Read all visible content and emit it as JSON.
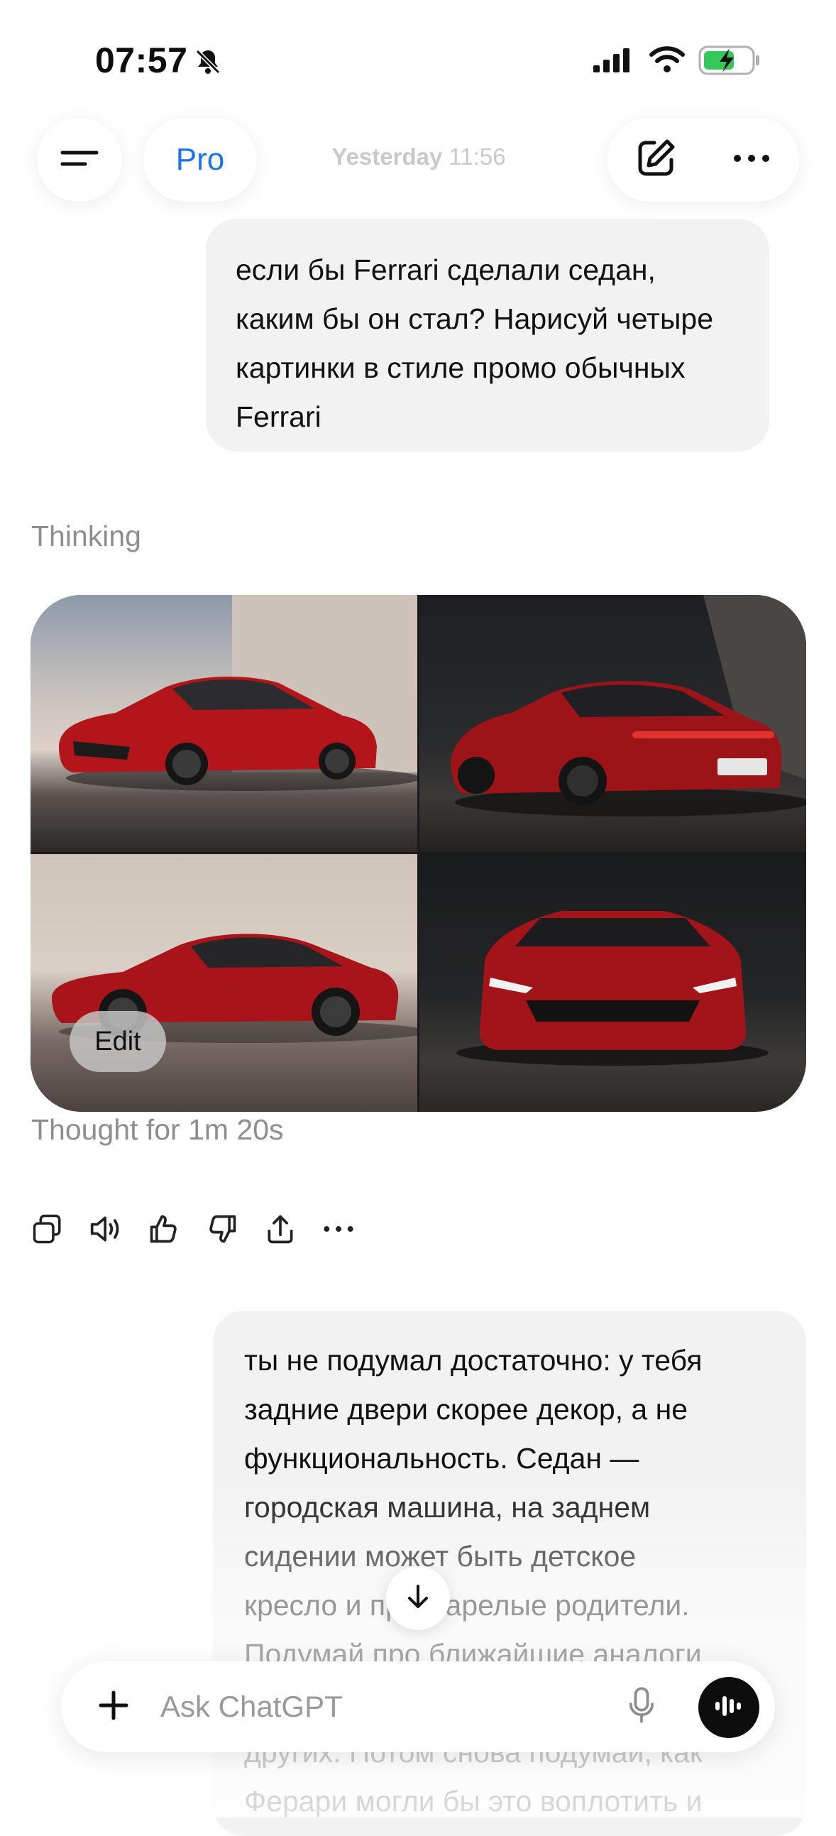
{
  "status_bar": {
    "time": "07:57",
    "icons": [
      "bell-slash-icon",
      "signal-icon",
      "wifi-icon",
      "battery-charging-icon"
    ],
    "battery_color": "#34c759"
  },
  "header": {
    "menu_icon": "menu-icon",
    "plan_label": "Pro",
    "timestamp_day": "Yesterday",
    "timestamp_time": "11:56",
    "actions": [
      "compose-icon",
      "more-icon"
    ],
    "accent_color": "#1a73e8"
  },
  "messages": {
    "user_1": "если бы Ferrari сделали седан, каким бы он стал? Нарисуй четыре картинки в стиле промо обычных Ferrari",
    "thinking_label": "Thinking",
    "images": [
      {
        "description": "red car front three-quarter view"
      },
      {
        "description": "red car rear three-quarter view"
      },
      {
        "description": "red car side profile"
      },
      {
        "description": "red car front view"
      }
    ],
    "edit_label": "Edit",
    "thought_duration": "Thought for 1m 20s",
    "actions": [
      "copy-icon",
      "speaker-icon",
      "thumbs-up-icon",
      "thumbs-down-icon",
      "share-icon",
      "more-icon"
    ],
    "user_2": "ты не подумал достаточно: у тебя\nзадние двери скорее декор, а не\nфункциональность. Седан —\nгородская машина, на заднем\nсидении может быть детское\nкресло и престарелые родители.\nПодумай про ближайшие аналоги\nу Porsche, Bentley, Maserati и\nдругих. Потом снова подумай, как\nФерари могли бы это воплотить и"
  },
  "composer": {
    "placeholder": "Ask ChatGPT",
    "icons": [
      "plus-icon",
      "microphone-icon",
      "voice-mode-icon"
    ]
  },
  "scroll_icon": "arrow-down-icon"
}
